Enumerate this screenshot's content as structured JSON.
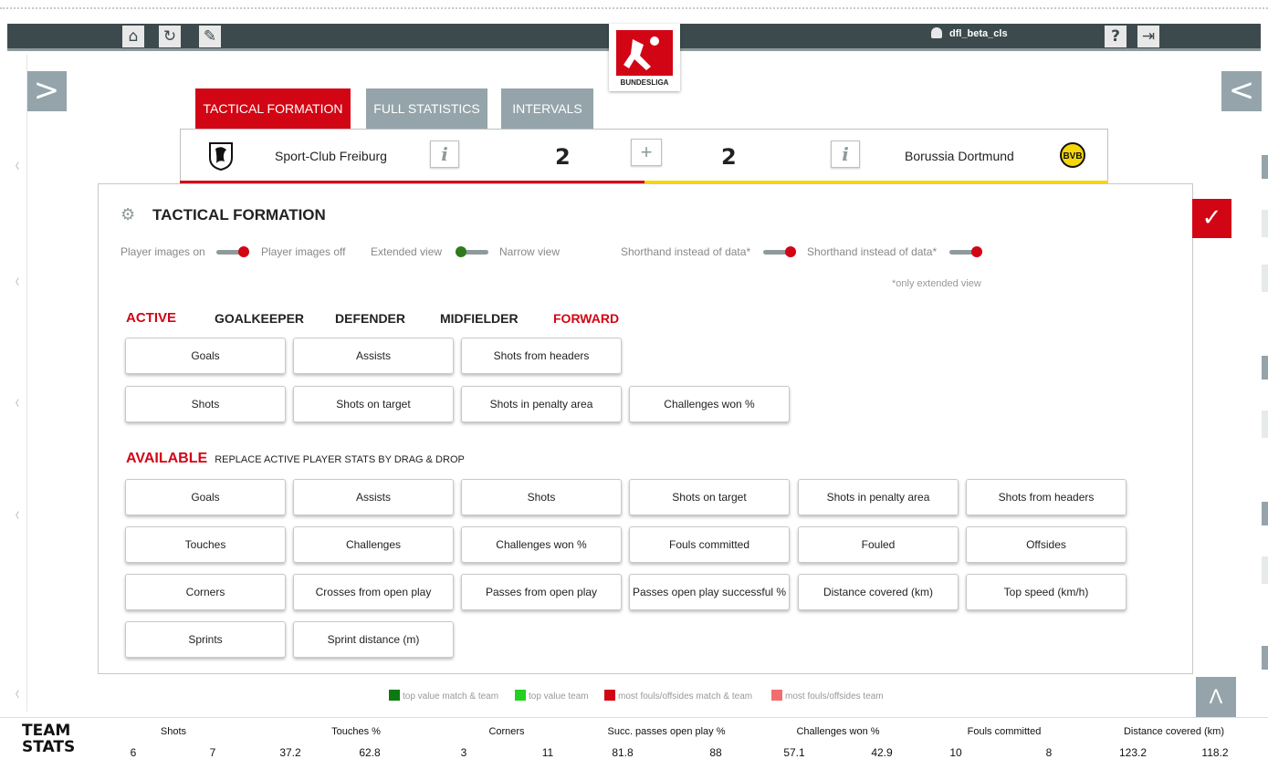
{
  "topbar": {
    "icons": [
      "home-icon",
      "refresh-icon",
      "edit-icon"
    ],
    "username": "dfl_beta_cls",
    "help_label": "?",
    "logout_icon": "logout-icon"
  },
  "logo": {
    "text": "BUNDESLIGA"
  },
  "nav": {
    "left_arrow": ">",
    "right_arrow": "<"
  },
  "tabs": [
    {
      "label": "TACTICAL FORMATION",
      "active": true
    },
    {
      "label": "FULL STATISTICS",
      "active": false
    },
    {
      "label": "INTERVALS",
      "active": false
    }
  ],
  "match": {
    "home_team": "Sport-Club Freiburg",
    "home_score": "2",
    "away_score": "2",
    "away_team": "Borussia Dortmund",
    "info_label": "i",
    "plus_label": "+",
    "home_color": "#d20515",
    "away_color": "#f5d70a"
  },
  "panel": {
    "title": "TACTICAL FORMATION",
    "toggles": [
      {
        "on_label": "Player images on",
        "off_label": "Player images off"
      },
      {
        "on_label": "Extended view",
        "off_label": "Narrow view"
      },
      {
        "label": "Shorthand instead of data*"
      },
      {
        "label": "Shorthand instead of data*"
      }
    ],
    "note": "*only extended view",
    "positions": {
      "active": "ACTIVE",
      "goalkeeper": "GOALKEEPER",
      "defender": "DEFENDER",
      "midfielder": "MIDFIELDER",
      "forward": "FORWARD"
    },
    "active_stats": [
      [
        "Goals",
        "Assists",
        "Shots from headers"
      ],
      [
        "Shots",
        "Shots on target",
        "Shots in penalty area",
        "Challenges won %"
      ]
    ],
    "available_title": "AVAILABLE",
    "available_hint": "REPLACE ACTIVE PLAYER STATS BY DRAG & DROP",
    "available_stats": [
      [
        "Goals",
        "Assists",
        "Shots",
        "Shots on target",
        "Shots in penalty area",
        "Shots from headers"
      ],
      [
        "Touches",
        "Challenges",
        "Challenges won %",
        "Fouls committed",
        "Fouled",
        "Offsides"
      ],
      [
        "Corners",
        "Crosses from open play",
        "Passes from open play",
        "Passes open play successful %",
        "Distance covered (km)",
        "Top speed (km/h)"
      ],
      [
        "Sprints",
        "Sprint distance (m)"
      ]
    ],
    "confirm_icon": "checkmark-icon"
  },
  "legend": [
    {
      "label": "top value match & team",
      "color": "#0b7a10"
    },
    {
      "label": "top value team",
      "color": "#22d022"
    },
    {
      "label": "most fouls/offsides match & team",
      "color": "#d20515"
    },
    {
      "label": "most fouls/offsides team",
      "color": "#f26d6d"
    }
  ],
  "up_button": "Λ",
  "team_stats": {
    "title_line1": "TEAM",
    "title_line2": "STATS",
    "columns": [
      {
        "label": "Shots",
        "home": "6",
        "away": "7"
      },
      {
        "label": "Touches %",
        "home": "37.2",
        "away": "62.8"
      },
      {
        "label": "Corners",
        "home": "3",
        "away": "11"
      },
      {
        "label": "Succ. passes open play %",
        "home": "81.8",
        "away": "88"
      },
      {
        "label": "Challenges won %",
        "home": "57.1",
        "away": "42.9"
      },
      {
        "label": "Fouls committed",
        "home": "10",
        "away": "8"
      },
      {
        "label": "Distance covered (km)",
        "home": "123.2",
        "away": "118.2"
      }
    ]
  }
}
